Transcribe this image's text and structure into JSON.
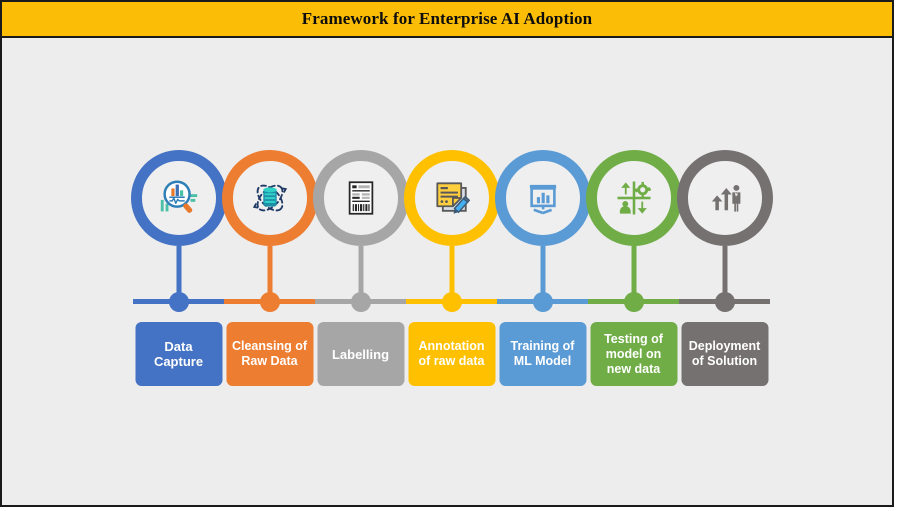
{
  "header": {
    "title": "Framework for Enterprise AI Adoption",
    "bar_color": "#FBBD05",
    "text_color": "#0D0D0D"
  },
  "canvas": {
    "background": "#EDEDED",
    "border_color": "#1A1A1A"
  },
  "process": {
    "type": "linear-timeline",
    "stage_count": 7,
    "stages": [
      {
        "index": 1,
        "label": "Data\nCapture",
        "label_line1": "Data",
        "label_line2": "Capture",
        "color": "#4472C4",
        "icon": "magnifier-bar-chart-icon"
      },
      {
        "index": 2,
        "label": "Cleansing of\nRaw Data",
        "label_line1": "Cleansing of",
        "label_line2": "Raw Data",
        "color": "#ED7D31",
        "icon": "atom-database-icon"
      },
      {
        "index": 3,
        "label": "Labelling",
        "label_line1": "Labelling",
        "label_line2": "",
        "color": "#A6A6A6",
        "icon": "barcode-label-document-icon"
      },
      {
        "index": 4,
        "label": "Annotation\nof raw data",
        "label_line1": "Annotation",
        "label_line2": "of raw data",
        "color": "#FFC000",
        "icon": "note-pencil-annotation-icon"
      },
      {
        "index": 5,
        "label": "Training of\nML Model",
        "label_line1": "Training of",
        "label_line2": "ML Model",
        "color": "#5B9BD5",
        "icon": "presentation-chart-icon"
      },
      {
        "index": 6,
        "label": "Testing of\nmodel on\nnew data",
        "label_line1": "Testing of",
        "label_line2": "model on",
        "label_line3": "new data",
        "color": "#70AD47",
        "icon": "quadrant-test-matrix-icon"
      },
      {
        "index": 7,
        "label": "Deployment\nof Solution",
        "label_line1": "Deployment",
        "label_line2": "of Solution",
        "color": "#767171",
        "icon": "growth-arrows-person-icon"
      }
    ]
  }
}
